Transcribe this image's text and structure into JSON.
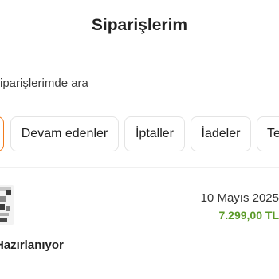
{
  "header": {
    "title": "Siparişlerim"
  },
  "search": {
    "placeholder": "Siparişlerimde ara"
  },
  "filters": [
    {
      "label": ""
    },
    {
      "label": "Devam edenler"
    },
    {
      "label": "İptaller"
    },
    {
      "label": "İadeler"
    },
    {
      "label": "Tekrar satın al"
    }
  ],
  "orders": [
    {
      "date": "10 Mayıs 2025",
      "price": "7.299,00 TL",
      "status": "Hazırlanıyor"
    }
  ],
  "colors": {
    "accent": "#f27a1a",
    "price": "#5a9a27"
  }
}
